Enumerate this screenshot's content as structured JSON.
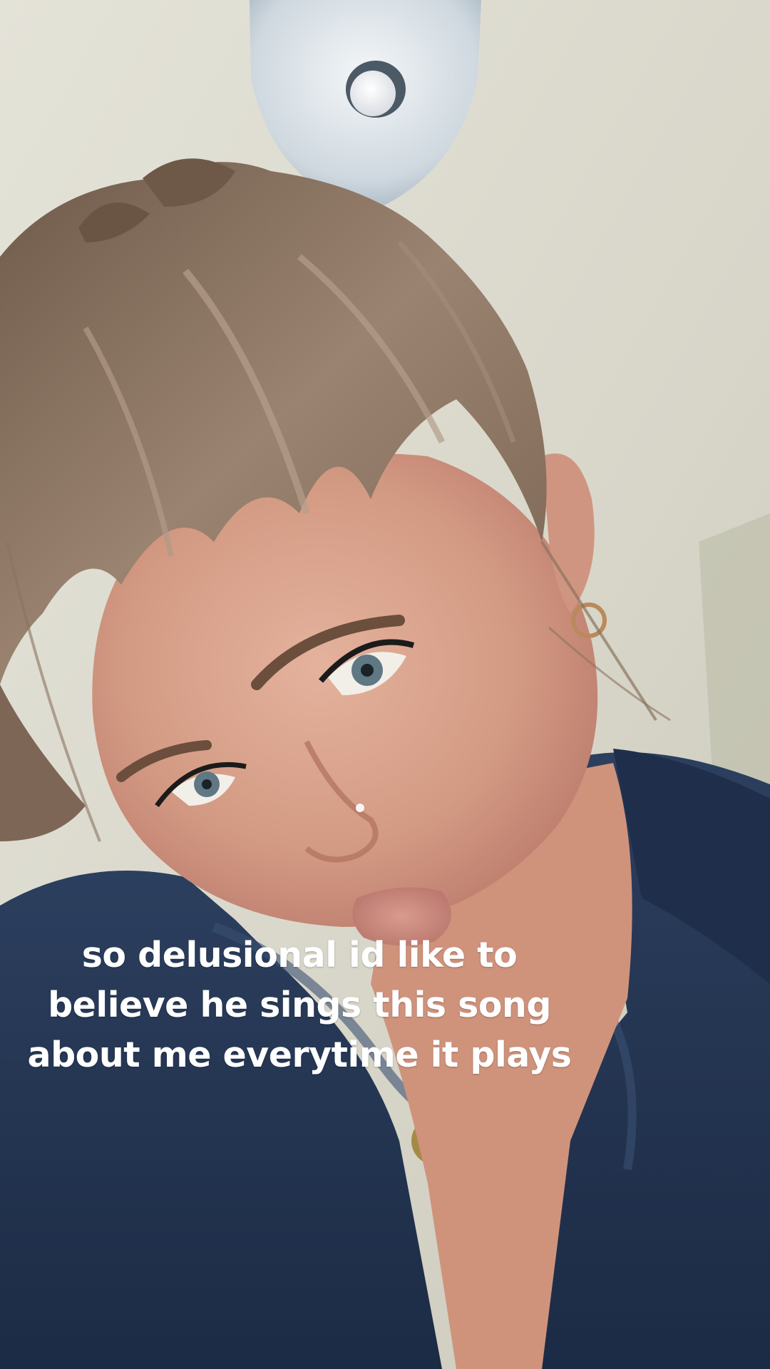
{
  "caption": {
    "lines": [
      "so delusional id like to",
      "believe he sings this song",
      "about me everytime it plays"
    ]
  },
  "colors": {
    "ceiling": "#dcdacd",
    "hair": "#8a7360",
    "skin": "#d79f8a",
    "jacket": "#253754",
    "lamp": "#d9e0e6",
    "text": "#ffffff"
  }
}
